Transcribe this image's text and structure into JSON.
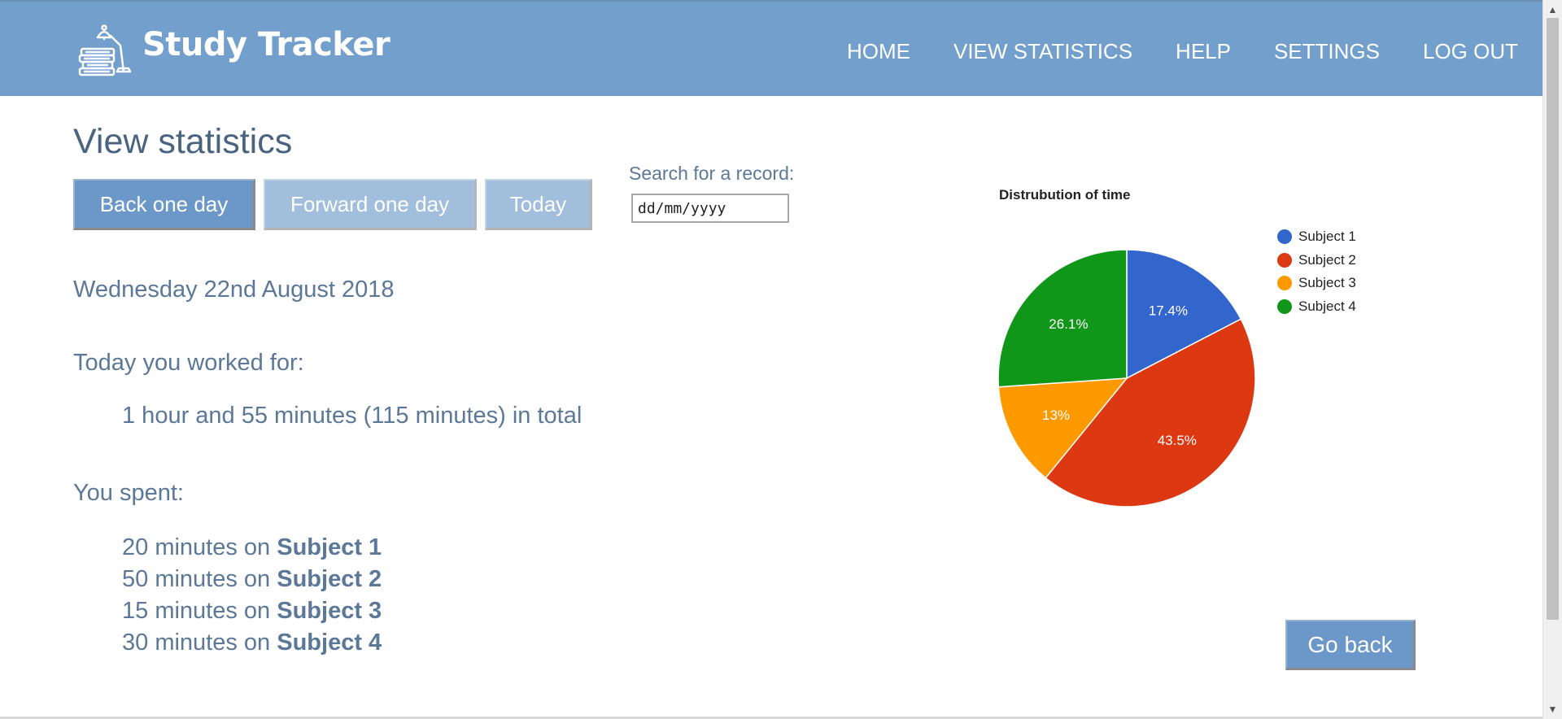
{
  "header": {
    "brand": "Study Tracker",
    "nav": [
      "HOME",
      "VIEW STATISTICS",
      "HELP",
      "SETTINGS",
      "LOG OUT"
    ],
    "bg_color": "#729fcc"
  },
  "main": {
    "title": "View statistics",
    "buttons": {
      "back": "Back one day",
      "forward": "Forward one day",
      "today": "Today"
    },
    "search": {
      "label": "Search for a record:",
      "placeholder": "dd/mm/yyyy"
    },
    "date": "Wednesday 22nd August 2018",
    "worked_label": "Today you worked for:",
    "worked_total": "1 hour and 55 minutes (115 minutes) in total",
    "spent_label": "You spent:",
    "spent": [
      {
        "prefix": "20 minutes on ",
        "subject": "Subject 1"
      },
      {
        "prefix": "50 minutes on ",
        "subject": "Subject 2"
      },
      {
        "prefix": "15 minutes on ",
        "subject": "Subject 3"
      },
      {
        "prefix": "30 minutes on ",
        "subject": "Subject 4"
      }
    ],
    "go_back": "Go back"
  },
  "chart_data": {
    "type": "pie",
    "title": "Distrubution of time",
    "categories": [
      "Subject 1",
      "Subject 2",
      "Subject 3",
      "Subject 4"
    ],
    "values": [
      20,
      50,
      15,
      30
    ],
    "labels": [
      "17.4%",
      "43.5%",
      "13%",
      "26.1%"
    ],
    "colors": [
      "#3366cc",
      "#dc3912",
      "#ff9900",
      "#109618"
    ],
    "legend": "right"
  }
}
